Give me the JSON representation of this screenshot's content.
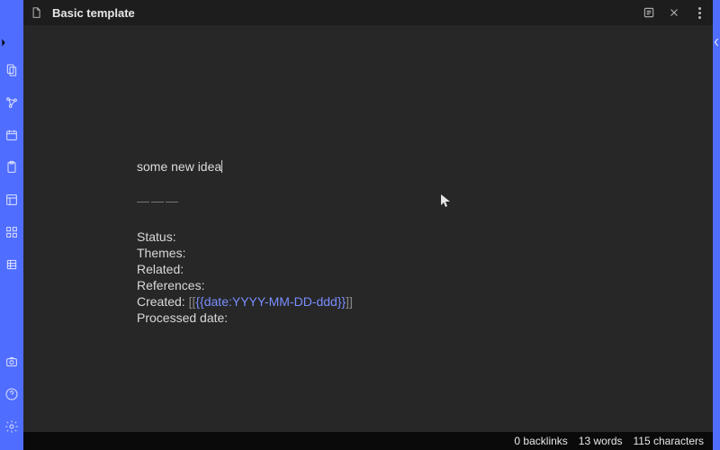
{
  "tab": {
    "title": "Basic template"
  },
  "note": {
    "title": "some new idea",
    "separator": "———",
    "meta": {
      "status_label": "Status:",
      "themes_label": "Themes:",
      "related_label": "Related:",
      "references_label": "References:",
      "created_label": "Created:",
      "created_link_outer_open": "[[",
      "created_link_template": "{{date:YYYY-MM-DD-ddd}}",
      "created_link_outer_close": "]]",
      "processed_label": "Processed date:"
    }
  },
  "status": {
    "backlinks": "0 backlinks",
    "words": "13 words",
    "characters": "115 characters"
  },
  "rail_icons": [
    "files-icon",
    "graph-icon",
    "calendar-icon",
    "clipboard-icon",
    "template-icon",
    "grid-icon",
    "database-icon",
    "camera-icon",
    "help-icon",
    "settings-icon"
  ]
}
